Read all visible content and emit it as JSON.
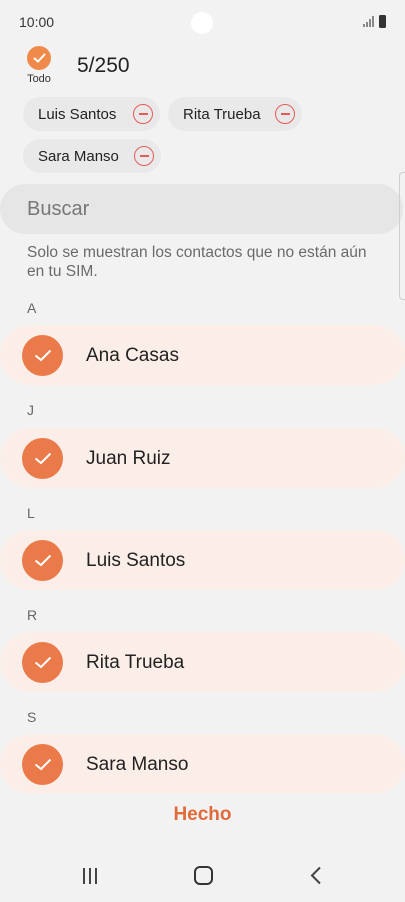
{
  "status": {
    "time": "10:00"
  },
  "header": {
    "select_all_label": "Todo",
    "count": "5/250"
  },
  "chips": [
    {
      "label": "Luis Santos"
    },
    {
      "label": "Rita Trueba"
    },
    {
      "label": "Sara Manso"
    }
  ],
  "search": {
    "placeholder": "Buscar"
  },
  "info_text": "Solo se muestran los contactos que no están aún en tu SIM.",
  "sections": [
    {
      "letter": "A",
      "contact": "Ana Casas",
      "checked": true
    },
    {
      "letter": "J",
      "contact": "Juan Ruiz",
      "checked": true
    },
    {
      "letter": "L",
      "contact": "Luis Santos",
      "checked": true
    },
    {
      "letter": "R",
      "contact": "Rita Trueba",
      "checked": true
    },
    {
      "letter": "S",
      "contact": "Sara Manso",
      "checked": true
    }
  ],
  "footer": {
    "done_label": "Hecho"
  },
  "colors": {
    "accent": "#ea7a4a",
    "row_bg": "#fbeee8",
    "done_text": "#e06a3a",
    "remove": "#e85a5a"
  }
}
